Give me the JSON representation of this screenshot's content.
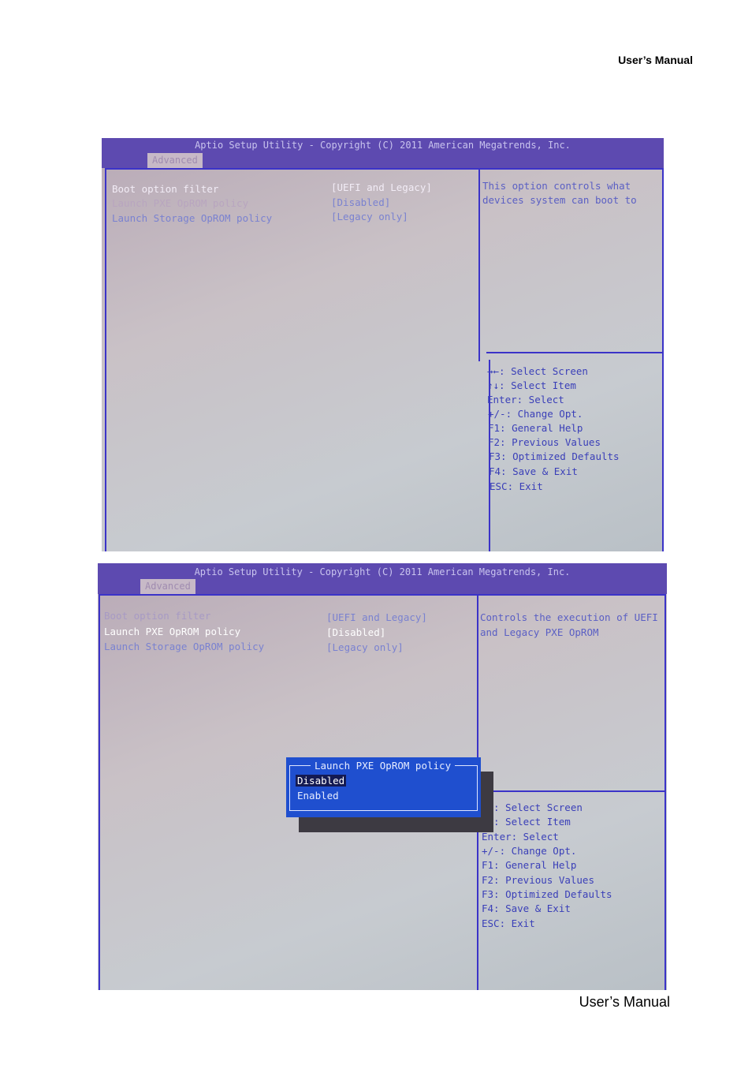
{
  "page": {
    "header": "User’s  Manual",
    "footer": "User’s  Manual"
  },
  "screen1": {
    "title": "Aptio Setup Utility - Copyright (C) 2011 American Megatrends, Inc.",
    "tab": "Advanced",
    "rows": [
      {
        "label": "Boot option filter",
        "value": "[UEFI and Legacy]"
      },
      {
        "label": "Launch PXE OpROM policy",
        "value": "[Disabled]"
      },
      {
        "label": "Launch Storage OpROM policy",
        "value": "[Legacy only]"
      }
    ],
    "help": [
      "This option controls what",
      "devices system can boot to"
    ],
    "keys": [
      "→←: Select Screen",
      "↑↓: Select Item",
      "Enter: Select",
      "+/-: Change Opt.",
      "F1: General Help",
      "F2: Previous Values",
      "F3: Optimized Defaults",
      "F4: Save & Exit",
      "ESC: Exit"
    ]
  },
  "screen2": {
    "title": "Aptio Setup Utility - Copyright (C) 2011 American Megatrends, Inc.",
    "tab": "Advanced",
    "rows": [
      {
        "label": "Boot option filter",
        "value": "[UEFI and Legacy]"
      },
      {
        "label": "Launch PXE OpROM policy",
        "value": "[Disabled]"
      },
      {
        "label": "Launch Storage OpROM policy",
        "value": "[Legacy only]"
      }
    ],
    "help": [
      "Controls the execution of UEFI",
      "and Legacy PXE OpROM"
    ],
    "keys": [
      ": Select Screen",
      ": Select Item",
      "Enter: Select",
      "+/-: Change Opt.",
      "F1: General Help",
      "F2: Previous Values",
      "F3: Optimized Defaults",
      "F4: Save & Exit",
      "ESC: Exit"
    ],
    "popup": {
      "title": "Launch PXE OpROM policy",
      "options": [
        "Disabled",
        "Enabled"
      ],
      "selected": "Disabled"
    }
  }
}
